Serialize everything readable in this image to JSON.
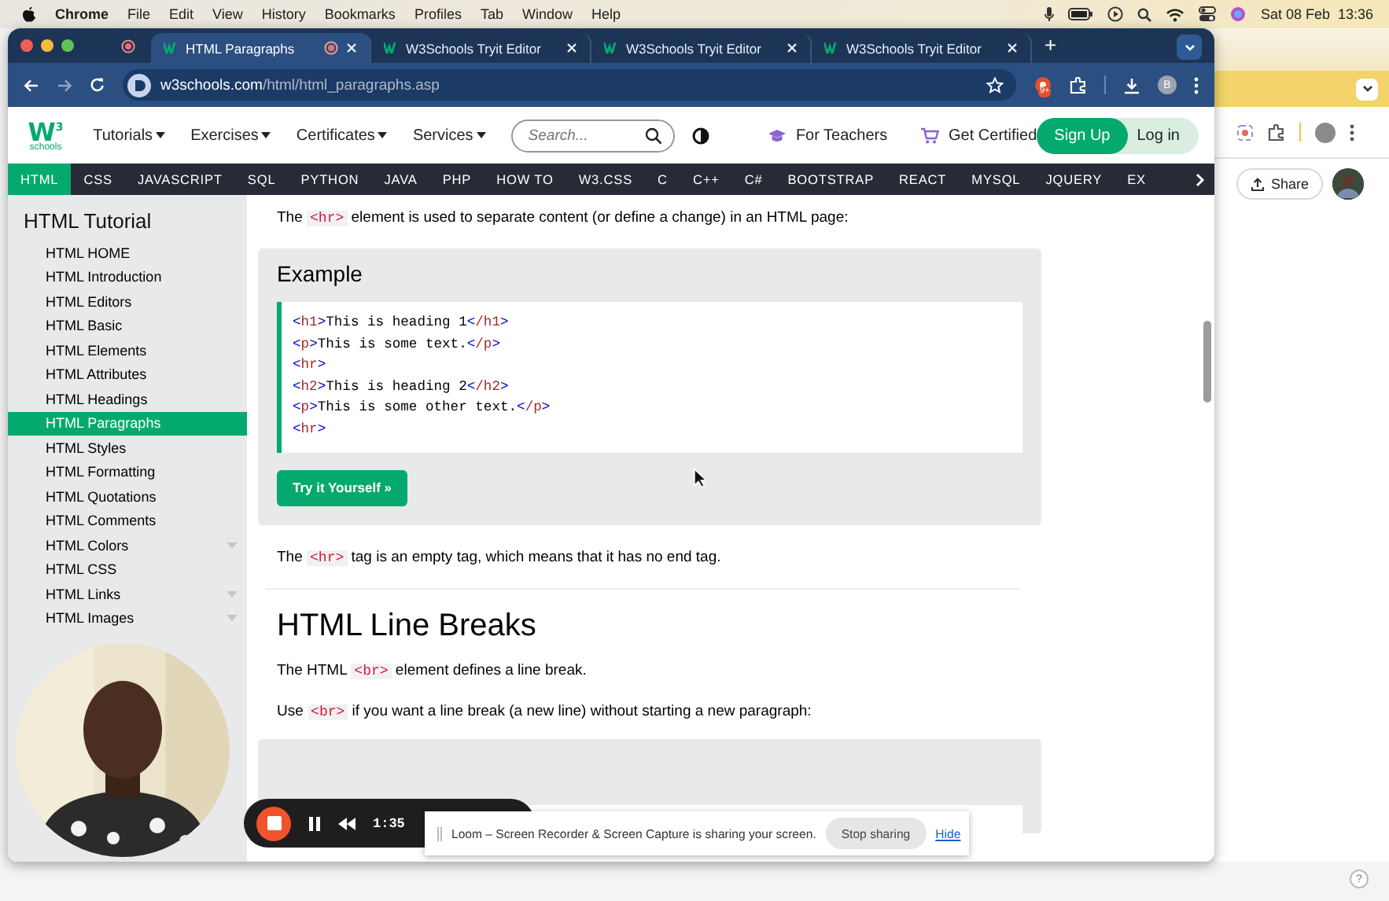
{
  "menubar": {
    "app": "Chrome",
    "items": [
      "File",
      "Edit",
      "View",
      "History",
      "Bookmarks",
      "Profiles",
      "Tab",
      "Window",
      "Help"
    ],
    "clock": "Sat 08 Feb  13:36"
  },
  "browser": {
    "tabs": [
      {
        "title": "HTML Paragraphs",
        "selected": true,
        "recording": true
      },
      {
        "title": "W3Schools Tryit Editor",
        "selected": false,
        "recording": false
      },
      {
        "title": "W3Schools Tryit Editor",
        "selected": false,
        "recording": false
      },
      {
        "title": "W3Schools Tryit Editor",
        "selected": false,
        "recording": false
      }
    ],
    "new_tab": "+",
    "address": {
      "host": "w3schools.com",
      "path": "/html/html_paragraphs.asp"
    },
    "extension_badge": "9+",
    "profile": "B"
  },
  "site": {
    "logo": {
      "mark": "W",
      "sup": "3",
      "word": "schools"
    },
    "menus": [
      "Tutorials",
      "Exercises",
      "Certificates",
      "Services"
    ],
    "search": {
      "placeholder": "Search..."
    },
    "teachers": "For Teachers",
    "certified": "Get Certified",
    "signup": "Sign Up",
    "login": "Log in",
    "topics": [
      {
        "label": "HTML",
        "selected": true
      },
      {
        "label": "CSS",
        "selected": false
      },
      {
        "label": "JAVASCRIPT",
        "selected": false
      },
      {
        "label": "SQL",
        "selected": false
      },
      {
        "label": "PYTHON",
        "selected": false
      },
      {
        "label": "JAVA",
        "selected": false
      },
      {
        "label": "PHP",
        "selected": false
      },
      {
        "label": "HOW TO",
        "selected": false
      },
      {
        "label": "W3.CSS",
        "selected": false
      },
      {
        "label": "C",
        "selected": false
      },
      {
        "label": "C++",
        "selected": false
      },
      {
        "label": "C#",
        "selected": false
      },
      {
        "label": "BOOTSTRAP",
        "selected": false
      },
      {
        "label": "REACT",
        "selected": false
      },
      {
        "label": "MYSQL",
        "selected": false
      },
      {
        "label": "JQUERY",
        "selected": false
      },
      {
        "label": "EX",
        "selected": false
      }
    ]
  },
  "sidebar": {
    "title": "HTML Tutorial",
    "items": [
      {
        "label": "HTML HOME",
        "selected": false,
        "has_submenu": false
      },
      {
        "label": "HTML Introduction",
        "selected": false,
        "has_submenu": false
      },
      {
        "label": "HTML Editors",
        "selected": false,
        "has_submenu": false
      },
      {
        "label": "HTML Basic",
        "selected": false,
        "has_submenu": false
      },
      {
        "label": "HTML Elements",
        "selected": false,
        "has_submenu": false
      },
      {
        "label": "HTML Attributes",
        "selected": false,
        "has_submenu": false
      },
      {
        "label": "HTML Headings",
        "selected": false,
        "has_submenu": false
      },
      {
        "label": "HTML Paragraphs",
        "selected": true,
        "has_submenu": false
      },
      {
        "label": "HTML Styles",
        "selected": false,
        "has_submenu": false
      },
      {
        "label": "HTML Formatting",
        "selected": false,
        "has_submenu": false
      },
      {
        "label": "HTML Quotations",
        "selected": false,
        "has_submenu": false
      },
      {
        "label": "HTML Comments",
        "selected": false,
        "has_submenu": false
      },
      {
        "label": "HTML Colors",
        "selected": false,
        "has_submenu": true
      },
      {
        "label": "HTML CSS",
        "selected": false,
        "has_submenu": false
      },
      {
        "label": "HTML Links",
        "selected": false,
        "has_submenu": true
      },
      {
        "label": "HTML Images",
        "selected": false,
        "has_submenu": true
      }
    ]
  },
  "content": {
    "intro": [
      {
        "kind": "text",
        "text": "The "
      },
      {
        "kind": "code",
        "text": "<hr>"
      },
      {
        "kind": "text",
        "text": " element is used to separate content (or define a change) in an HTML page:"
      }
    ],
    "example": {
      "title": "Example",
      "code": [
        [
          {
            "kind": "bracket",
            "text": "<"
          },
          {
            "kind": "tag",
            "text": "h1"
          },
          {
            "kind": "bracket",
            "text": ">"
          },
          {
            "kind": "text",
            "text": "This is heading 1"
          },
          {
            "kind": "bracket",
            "text": "<"
          },
          {
            "kind": "tag",
            "text": "/h1"
          },
          {
            "kind": "bracket",
            "text": ">"
          }
        ],
        [
          {
            "kind": "bracket",
            "text": "<"
          },
          {
            "kind": "tag",
            "text": "p"
          },
          {
            "kind": "bracket",
            "text": ">"
          },
          {
            "kind": "text",
            "text": "This is some text."
          },
          {
            "kind": "bracket",
            "text": "<"
          },
          {
            "kind": "tag",
            "text": "/p"
          },
          {
            "kind": "bracket",
            "text": ">"
          }
        ],
        [
          {
            "kind": "bracket",
            "text": "<"
          },
          {
            "kind": "tag",
            "text": "hr"
          },
          {
            "kind": "bracket",
            "text": ">"
          }
        ],
        [
          {
            "kind": "bracket",
            "text": "<"
          },
          {
            "kind": "tag",
            "text": "h2"
          },
          {
            "kind": "bracket",
            "text": ">"
          },
          {
            "kind": "text",
            "text": "This is heading 2"
          },
          {
            "kind": "bracket",
            "text": "<"
          },
          {
            "kind": "tag",
            "text": "/h2"
          },
          {
            "kind": "bracket",
            "text": ">"
          }
        ],
        [
          {
            "kind": "bracket",
            "text": "<"
          },
          {
            "kind": "tag",
            "text": "p"
          },
          {
            "kind": "bracket",
            "text": ">"
          },
          {
            "kind": "text",
            "text": "This is some other text."
          },
          {
            "kind": "bracket",
            "text": "<"
          },
          {
            "kind": "tag",
            "text": "/p"
          },
          {
            "kind": "bracket",
            "text": ">"
          }
        ],
        [
          {
            "kind": "bracket",
            "text": "<"
          },
          {
            "kind": "tag",
            "text": "hr"
          },
          {
            "kind": "bracket",
            "text": ">"
          }
        ]
      ],
      "button": "Try it Yourself »"
    },
    "note": [
      {
        "kind": "text",
        "text": "The "
      },
      {
        "kind": "code",
        "text": "<hr>"
      },
      {
        "kind": "text",
        "text": " tag is an empty tag, which means that it has no end tag."
      }
    ],
    "heading": "HTML Line Breaks",
    "paragraphs": [
      [
        {
          "kind": "text",
          "text": "The HTML "
        },
        {
          "kind": "code",
          "text": "<br>"
        },
        {
          "kind": "text",
          "text": " element defines a line break."
        }
      ],
      [
        {
          "kind": "text",
          "text": "Use "
        },
        {
          "kind": "code",
          "text": "<br>"
        },
        {
          "kind": "text",
          "text": " if you want a line break (a new line) without starting a new paragraph:"
        }
      ]
    ]
  },
  "recorder": {
    "time": "1:35"
  },
  "share_notice": {
    "text": "Loom – Screen Recorder & Screen Capture is sharing your screen.",
    "stop": "Stop sharing",
    "hide": "Hide"
  },
  "side_window": {
    "share": "Share"
  },
  "help": "?"
}
